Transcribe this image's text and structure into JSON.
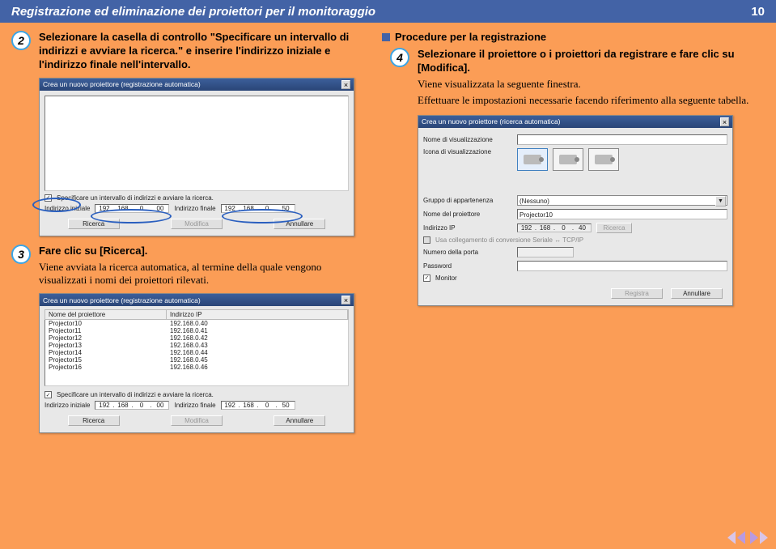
{
  "header": {
    "title": "Registrazione ed eliminazione dei proiettori per il monitoraggio",
    "page": "10"
  },
  "step2": {
    "num": "2",
    "text": "Selezionare la casella di controllo \"Specificare un intervallo di indirizzi e avviare la ricerca.\" e inserire l'indirizzo iniziale e l'indirizzo finale nell'intervallo."
  },
  "step3": {
    "num": "3",
    "title": "Fare clic su [Ricerca].",
    "text": "Viene avviata la ricerca automatica, al termine della quale vengono visualizzati i nomi dei proiettori rilevati."
  },
  "procedure_title": "Procedure per la registrazione",
  "step4": {
    "num": "4",
    "title": "Selezionare il proiettore o i proiettori da registrare e fare clic su [Modifica].",
    "text1": "Viene visualizzata la seguente finestra.",
    "text2": "Effettuare le impostazioni necessarie facendo riferimento alla seguente tabella."
  },
  "dialog1": {
    "title": "Crea un nuovo proiettore (registrazione automatica)",
    "check_label": "Specificare un intervallo di indirizzi e avviare la ricerca.",
    "lbl_init": "Indirizzo iniziale",
    "lbl_final": "Indirizzo finale",
    "ip_init": [
      "192",
      "168",
      "0",
      "00"
    ],
    "ip_final": [
      "192",
      "168",
      "0",
      "50"
    ],
    "btn_search": "Ricerca",
    "btn_modify": "Modifica",
    "btn_cancel": "Annullare"
  },
  "dialog3": {
    "title": "Crea un nuovo proiettore (registrazione automatica)",
    "col_name": "Nome del proiettore",
    "col_ip": "Indirizzo IP",
    "rows": [
      {
        "name": "Projector10",
        "ip": "192.168.0.40"
      },
      {
        "name": "Projector11",
        "ip": "192.168.0.41"
      },
      {
        "name": "Projector12",
        "ip": "192.168.0.42"
      },
      {
        "name": "Projector13",
        "ip": "192.168.0.43"
      },
      {
        "name": "Projector14",
        "ip": "192.168.0.44"
      },
      {
        "name": "Projector15",
        "ip": "192.168.0.45"
      },
      {
        "name": "Projector16",
        "ip": "192.168.0.46"
      }
    ],
    "check_label": "Specificare un intervallo di indirizzi e avviare la ricerca.",
    "lbl_init": "Indirizzo iniziale",
    "lbl_final": "Indirizzo finale",
    "ip_init": [
      "192",
      "168",
      "0",
      "00"
    ],
    "ip_final": [
      "192",
      "168",
      "0",
      "50"
    ],
    "btn_search": "Ricerca",
    "btn_modify": "Modifica",
    "btn_cancel": "Annullare"
  },
  "dialog4": {
    "title": "Crea un nuovo proiettore (ricerca automatica)",
    "lbl_dispname": "Nome di visualizzazione",
    "lbl_icon": "Icona di visualizzazione",
    "lbl_group": "Gruppo di appartenenza",
    "group_val": "(Nessuno)",
    "lbl_projname": "Nome del proiettore",
    "projname_val": "Projector10",
    "lbl_ip": "Indirizzo IP",
    "ip": [
      "192",
      "168",
      "0",
      "40"
    ],
    "btn_search": "Ricerca",
    "chk_serial": "Usa collegamento di conversione Seriale ↔ TCP/IP",
    "lbl_port": "Numero della porta",
    "lbl_pwd": "Password",
    "chk_monitor": "Monitor",
    "btn_register": "Registra",
    "btn_cancel": "Annullare"
  }
}
